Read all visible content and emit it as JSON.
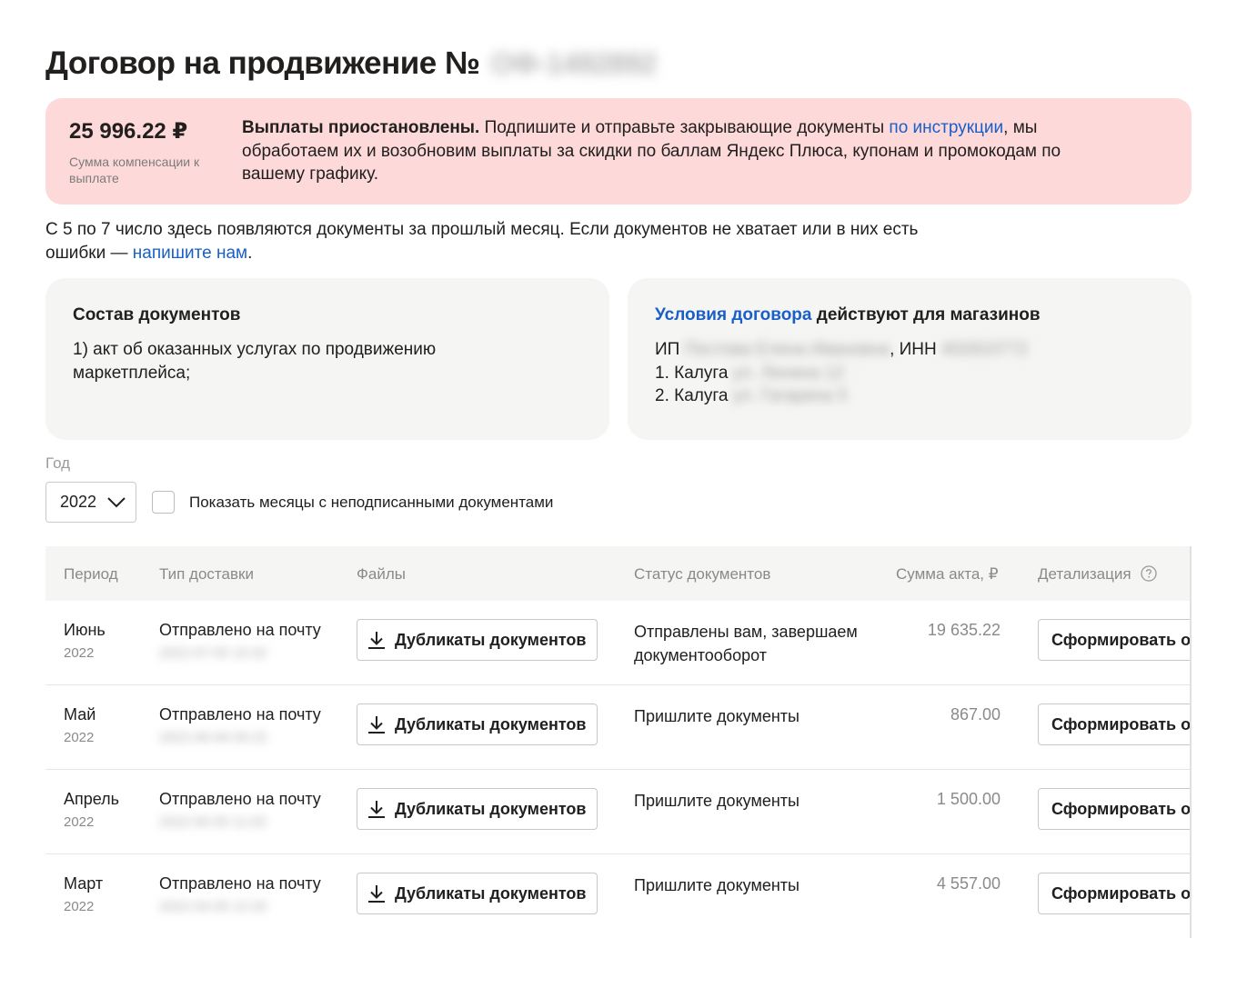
{
  "header": {
    "title": "Договор на продвижение №",
    "number_hidden": "ОФ-1492892"
  },
  "alert": {
    "amount": "25 996.22 ₽",
    "amount_label": "Сумма компенсации к выплате",
    "bold": "Выплаты приостановлены.",
    "text_before_link": "Подпишите и отправьте закрывающие документы",
    "link": "по инструкции",
    "text_after_link": ", мы обработаем их и возобновим выплаты за скидки по баллам Яндекс Плюса, купонам и промокодам по вашему графику."
  },
  "info": {
    "text": "С 5 по 7 число здесь появляются документы за прошлый месяц. Если документов не хватает или в них есть ошибки —",
    "link": "напишите нам",
    "end": "."
  },
  "docs_card": {
    "title": "Состав документов",
    "item": "1) акт об оказанных услугах по продвижению маркетплейса;"
  },
  "contract_card": {
    "title_link": "Условия договора",
    "title_rest": "действуют для магазинов",
    "ip_prefix": "ИП",
    "ip_name_hidden": "Пестова Елена Ивановна",
    "inn_label": ", ИНН",
    "inn_hidden": "402810772",
    "shops": [
      {
        "index": "1.",
        "name": "Калуга",
        "hidden": "ул. Ленина 12"
      },
      {
        "index": "2.",
        "name": "Калуга",
        "hidden": "ул. Гагарина 5"
      }
    ]
  },
  "filters": {
    "year_label": "Год",
    "year_value": "2022",
    "checkbox_label": "Показать месяцы с неподписанными документами"
  },
  "table": {
    "headers": {
      "period": "Период",
      "delivery": "Тип доставки",
      "files": "Файлы",
      "status": "Статус документов",
      "amount": "Сумма акта, ₽",
      "details": "Детализация"
    },
    "rows": [
      {
        "month": "Июнь",
        "year": "2022",
        "delivery": "Отправлено на почту",
        "delivery_hidden": "2022-07-05 10:42",
        "files_button": "Дубликаты документов",
        "status": "Отправлены вам, завершаем документооборот",
        "amount": "19 635.22",
        "details_button": "Сформировать отчёт"
      },
      {
        "month": "Май",
        "year": "2022",
        "delivery": "Отправлено на почту",
        "delivery_hidden": "2022-06-06 09:15",
        "files_button": "Дубликаты документов",
        "status": "Пришлите документы",
        "amount": "867.00",
        "details_button": "Сформировать отчёт"
      },
      {
        "month": "Апрель",
        "year": "2022",
        "delivery": "Отправлено на почту",
        "delivery_hidden": "2022-05-05 11:03",
        "files_button": "Дубликаты документов",
        "status": "Пришлите документы",
        "amount": "1 500.00",
        "details_button": "Сформировать отчёт"
      },
      {
        "month": "Март",
        "year": "2022",
        "delivery": "Отправлено на почту",
        "delivery_hidden": "2022-04-05 12:20",
        "files_button": "Дубликаты документов",
        "status": "Пришлите документы",
        "amount": "4 557.00",
        "details_button": "Сформировать отчёт"
      }
    ]
  },
  "icons": {
    "download": "download-icon",
    "chevron": "chevron-down-icon",
    "help": "help-circle-icon"
  },
  "colors": {
    "alert_bg": "#fdd9d9",
    "link": "#1a5ec7",
    "card_bg": "#f5f5f4"
  }
}
